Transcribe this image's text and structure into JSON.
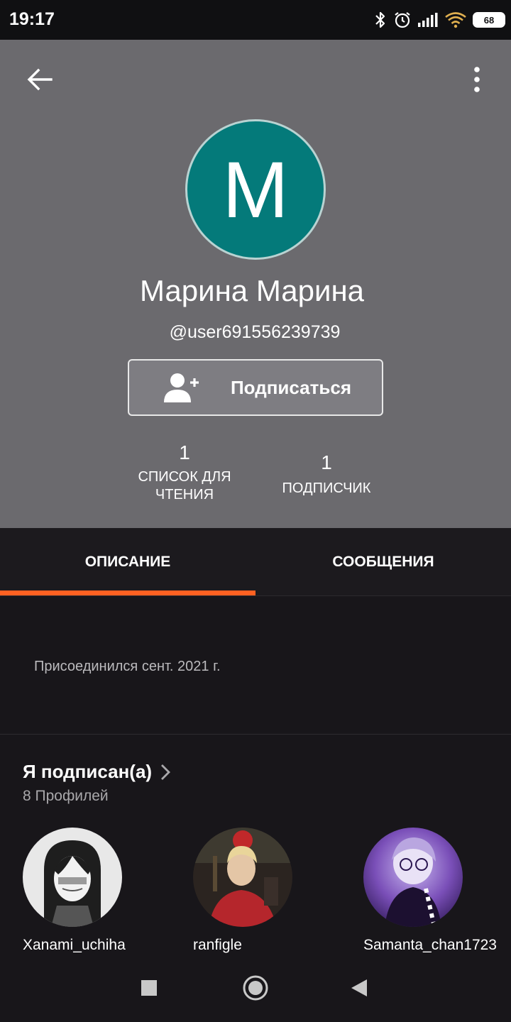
{
  "status_bar": {
    "time": "19:17",
    "battery": "68"
  },
  "header": {
    "back_icon": "arrow-left-icon",
    "more_icon": "more-vertical-icon",
    "avatar_letter": "M",
    "avatar_color": "#047a7a",
    "name": "Марина Марина",
    "handle": "@user691556239739",
    "follow_button": "Подписаться",
    "stats": {
      "reading_lists_count": "1",
      "reading_lists_label_line1": "СПИСОК ДЛЯ",
      "reading_lists_label_line2": "ЧТЕНИЯ",
      "followers_count": "1",
      "followers_label": "ПОДПИСЧИК"
    }
  },
  "tabs": [
    {
      "label": "ОПИСАНИЕ",
      "active": true
    },
    {
      "label": "СООБЩЕНИЯ",
      "active": false
    }
  ],
  "accent_color": "#ff6122",
  "description": {
    "joined": "Присоединился сент. 2021 г."
  },
  "following": {
    "title": "Я подписан(а)",
    "count_label": "8 Профилей",
    "profiles": [
      {
        "username": "Xanami_uchiha"
      },
      {
        "username": "ranfigle"
      },
      {
        "username": "Samanta_chan1723"
      }
    ]
  },
  "nav_bar": {
    "recents_icon": "square-icon",
    "home_icon": "circle-icon",
    "back_icon": "triangle-back-icon"
  }
}
